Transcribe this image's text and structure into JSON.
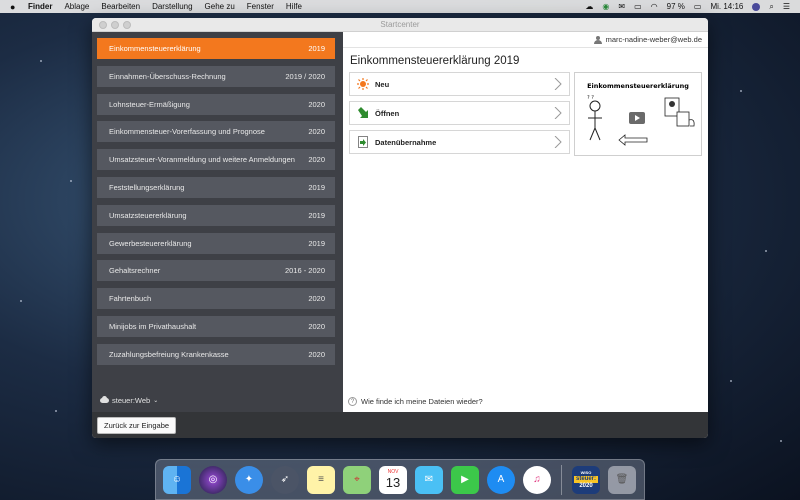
{
  "menubar": {
    "app": "Finder",
    "items": [
      "Ablage",
      "Bearbeiten",
      "Darstellung",
      "Gehe zu",
      "Fenster",
      "Hilfe"
    ],
    "battery": "97 %",
    "clock": "Mi. 14:16"
  },
  "window": {
    "title": "Startcenter"
  },
  "sidebar": {
    "items": [
      {
        "label": "Einkommensteuererklärung",
        "year": "2019",
        "active": true
      },
      {
        "label": "Einnahmen-Überschuss-Rechnung",
        "year": "2019 / 2020"
      },
      {
        "label": "Lohnsteuer-Ermäßigung",
        "year": "2020"
      },
      {
        "label": "Einkommensteuer-Vorerfassung und Prognose",
        "year": "2020"
      },
      {
        "label": "Umsatzsteuer-Voranmeldung und weitere Anmeldungen",
        "year": "2020"
      },
      {
        "label": "Feststellungserklärung",
        "year": "2019"
      },
      {
        "label": "Umsatzsteuererklärung",
        "year": "2019"
      },
      {
        "label": "Gewerbesteuererklärung",
        "year": "2019"
      },
      {
        "label": "Gehaltsrechner",
        "year": "2016 - 2020"
      },
      {
        "label": "Fahrtenbuch",
        "year": "2020"
      },
      {
        "label": "Minijobs im Privathaushalt",
        "year": "2020"
      },
      {
        "label": "Zuzahlungsbefreiung Krankenkasse",
        "year": "2020"
      }
    ],
    "footer": "steuer:Web"
  },
  "main": {
    "user_email": "marc-nadine-weber@web.de",
    "title": "Einkommensteuererklärung 2019",
    "actions": [
      {
        "label": "Neu",
        "icon": "sun-icon"
      },
      {
        "label": "Öffnen",
        "icon": "arrow-down-right-icon"
      },
      {
        "label": "Datenübernahme",
        "icon": "document-import-icon"
      }
    ],
    "video_title": "Einkommensteuererklärung",
    "help_text": "Wie finde ich meine Dateien wieder?"
  },
  "bottombar": {
    "back_label": "Zurück zur Eingabe"
  },
  "dock": {
    "apps": [
      "finder-icon",
      "siri-icon",
      "safari-icon",
      "launchpad-icon",
      "notes-icon",
      "maps-icon",
      "calendar-icon",
      "messages-icon",
      "facetime-icon",
      "app-store-icon",
      "itunes-icon",
      "steuer-icon",
      "trash-icon"
    ],
    "calendar_month": "NOV",
    "calendar_day": "13",
    "steuer_brand": "WISO",
    "steuer_name": "steuer:",
    "steuer_year": "2020"
  },
  "colors": {
    "accent": "#f3781e",
    "sidebar_bg": "#3e4046",
    "sidebar_item": "#555860"
  }
}
